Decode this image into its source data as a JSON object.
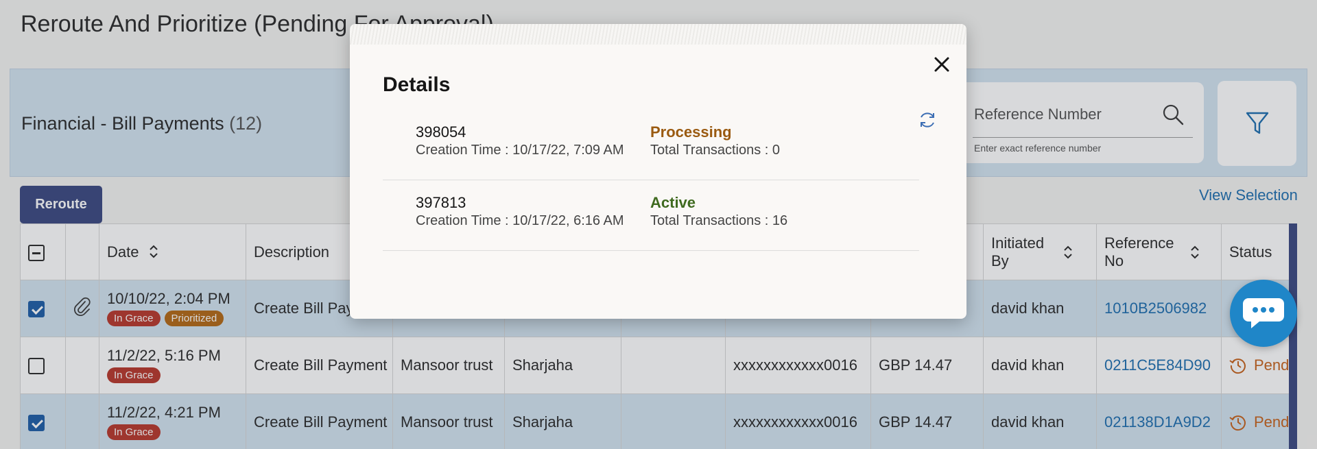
{
  "page": {
    "title": "Reroute And Prioritize (Pending For Approval)"
  },
  "summary": {
    "title": "Financial - Bill Payments",
    "count": "(12)"
  },
  "search": {
    "placeholder": "Reference Number",
    "hint": "Enter exact reference number"
  },
  "toolbar": {
    "reroute_label": "Reroute",
    "view_selection_label": "View Selection"
  },
  "table": {
    "headers": {
      "date": "Date",
      "description": "Description",
      "initiated_by": "Initiated By",
      "reference_no": "Reference No",
      "status": "Status"
    },
    "rows": [
      {
        "selected": true,
        "attachment": true,
        "date": "10/10/22, 2:04 PM",
        "badges": [
          "In Grace",
          "Prioritized"
        ],
        "description": "Create Bill Payment",
        "payee": "",
        "location": "",
        "col6": "",
        "account": "",
        "amount": "",
        "initiated_by": "david khan",
        "reference_no": "1010B2506982",
        "status": ""
      },
      {
        "selected": false,
        "attachment": false,
        "date": "11/2/22, 5:16 PM",
        "badges": [
          "In Grace"
        ],
        "description": "Create Bill Payment",
        "payee": "Mansoor trust",
        "location": "Sharjaha",
        "col6": "",
        "account": "xxxxxxxxxxxx0016",
        "amount": "GBP 14.47",
        "initiated_by": "david khan",
        "reference_no": "0211C5E84D90",
        "status": "Pend"
      },
      {
        "selected": true,
        "attachment": false,
        "date": "11/2/22, 4:21 PM",
        "badges": [
          "In Grace"
        ],
        "description": "Create Bill Payment",
        "payee": "Mansoor trust",
        "location": "Sharjaha",
        "col6": "",
        "account": "xxxxxxxxxxxx0016",
        "amount": "GBP 14.47",
        "initiated_by": "david khan",
        "reference_no": "021138D1A9D2",
        "status": "Pend"
      }
    ]
  },
  "modal": {
    "title": "Details",
    "items": [
      {
        "id": "398054",
        "creation": "Creation Time : 10/17/22, 7:09 AM",
        "status": "Processing",
        "transactions": "Total Transactions : 0"
      },
      {
        "id": "397813",
        "creation": "Creation Time : 10/17/22, 6:16 AM",
        "status": "Active",
        "transactions": "Total Transactions : 16"
      }
    ]
  },
  "colors": {
    "accent": "#3c4a82",
    "link": "#1f6fb0",
    "grace_badge": "#b9392c",
    "prioritized_badge": "#b46a16",
    "processing": "#9a5a10",
    "active": "#3f6a1f",
    "chat": "#1f86c8"
  },
  "icons": {
    "search": "search-icon",
    "filter": "filter-icon",
    "close": "close-icon",
    "refresh": "refresh-icon",
    "attachment": "paperclip-icon",
    "status_pending": "clock-history-icon",
    "chat": "chat-icon"
  }
}
